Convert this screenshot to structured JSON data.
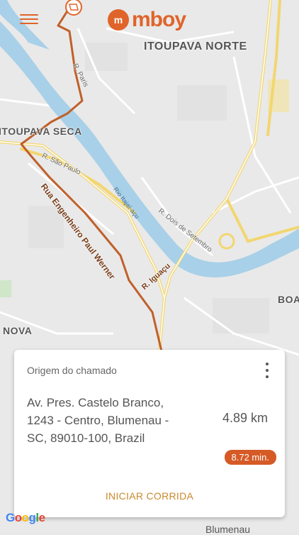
{
  "header": {
    "menu_icon": "hamburger-menu-icon",
    "logo_mark": "m",
    "logo_text": "mboy",
    "brand_color": "#e0642a"
  },
  "map": {
    "districts": [
      "ITOUPAVA NORTE",
      "ITOUPAVA SECA",
      "NOVA",
      "BOA"
    ],
    "streets": [
      "R. Paris",
      "R. São Paulo",
      "R. Dois de Setembro"
    ],
    "route_streets": [
      "Rua Engenheiro Paul Werner",
      "R. Iguaçu"
    ],
    "river": "Rio Itajaí-açu",
    "bottom_label": "Blumenau",
    "attribution": "Google",
    "route_color": "#c0602a",
    "river_color": "#a8d0e8"
  },
  "card": {
    "title": "Origem do chamado",
    "options_icon": "more-vertical-icon",
    "address_lines": [
      "Av. Pres. Castelo Branco,",
      "1243 - Centro, Blumenau -",
      "SC, 89010-100, Brazil"
    ],
    "distance": "4.89 km",
    "time": "8.72 min.",
    "action_label": "INICIAR CORRIDA"
  }
}
